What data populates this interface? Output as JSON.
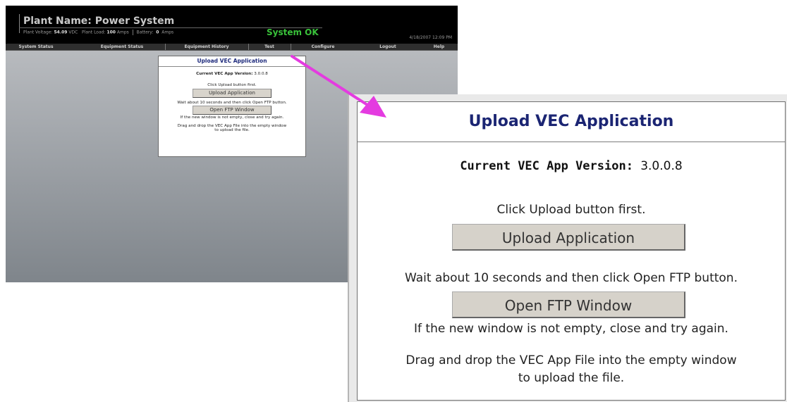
{
  "header": {
    "plant_title": "Plant Name: Power System",
    "stats": {
      "voltage_label": "Plant Voltage:",
      "voltage_value": "54.09",
      "voltage_unit": "VDC",
      "load_label": "Plant Load:",
      "load_value": "100",
      "load_unit": "Amps",
      "battery_label": "Battery:",
      "battery_value": "0",
      "battery_unit": "Amps"
    },
    "system_status": "System OK",
    "datetime": "4/18/2007 12:09 PM"
  },
  "nav": {
    "items": [
      "System Status",
      "Equipment Status",
      "Equipment History",
      "Test",
      "Configure",
      "Logout",
      "Help"
    ]
  },
  "dialog": {
    "title": "Upload VEC Application",
    "version_label": "Current VEC App Version:",
    "version_value": "3.0.0.8",
    "step1_text": "Click Upload button first.",
    "upload_button": "Upload Application",
    "step2_text": "Wait about 10 seconds and then click Open FTP button.",
    "ftp_button": "Open FTP Window",
    "step3_text": "If the new window is not empty, close and try again.",
    "step4_line1": "Drag and drop the VEC App File into the empty window",
    "step4_line2": "to upload the file."
  },
  "colors": {
    "arrow": "#e43be0",
    "status_ok": "#39c23a",
    "dialog_title": "#1b2573"
  }
}
